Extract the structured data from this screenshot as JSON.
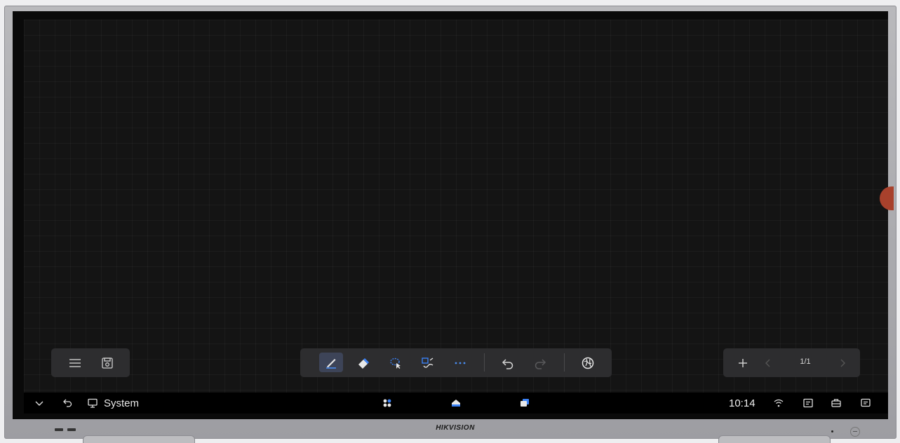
{
  "whiteboard": {
    "left_toolbar": {
      "menu_icon": "menu-icon",
      "save_icon": "save-icon"
    },
    "center_toolbar": {
      "tools": [
        {
          "name": "pen-icon",
          "selected": true
        },
        {
          "name": "eraser-icon",
          "selected": false
        },
        {
          "name": "lasso-select-icon",
          "selected": false
        },
        {
          "name": "shape-recognize-icon",
          "selected": false
        },
        {
          "name": "more-icon",
          "selected": false
        },
        {
          "name": "undo-icon",
          "selected": false
        },
        {
          "name": "redo-icon",
          "selected": false
        },
        {
          "name": "browser-icon",
          "selected": false
        }
      ]
    },
    "right_toolbar": {
      "add_page_icon": "plus-icon",
      "prev_icon": "chevron-left-icon",
      "next_icon": "chevron-right-icon",
      "page_indicator": "1/1"
    }
  },
  "taskbar": {
    "collapse_icon": "chevron-down-icon",
    "back_icon": "back-icon",
    "source_icon": "monitor-icon",
    "source_label": "System",
    "apps_icon": "apps-icon",
    "home_icon": "home-icon",
    "recent_icon": "recent-apps-icon",
    "time": "10:14",
    "status_icons": [
      "wifi-icon",
      "screen-icon",
      "toolbox-icon",
      "message-icon"
    ]
  },
  "device": {
    "brand": "HIKVISION"
  },
  "colors": {
    "canvas": "#141414",
    "toolbar": "#2d2d2f",
    "accent_blue": "#3b82f6",
    "side_handle": "#a8412c"
  }
}
